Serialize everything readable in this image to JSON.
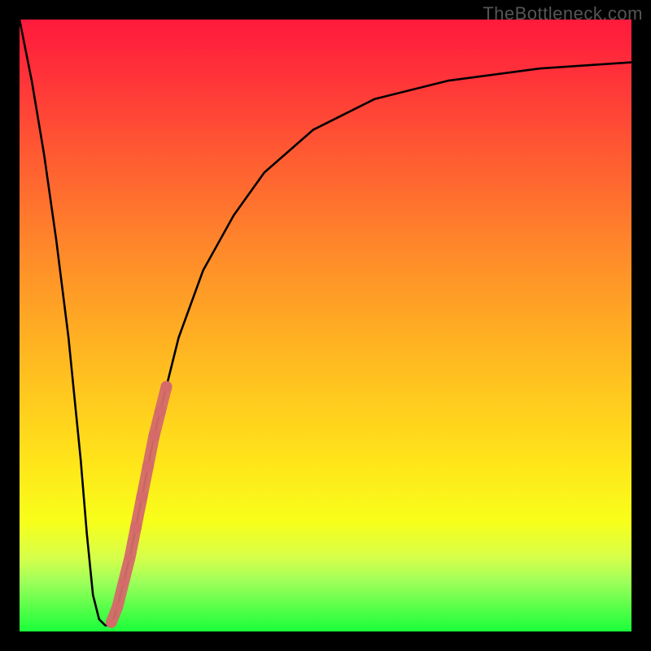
{
  "watermark": "TheBottleneck.com",
  "chart_data": {
    "type": "line",
    "title": "",
    "xlabel": "",
    "ylabel": "",
    "xlim": [
      0,
      100
    ],
    "ylim": [
      0,
      100
    ],
    "series": [
      {
        "name": "bottleneck-curve",
        "x": [
          0,
          2,
          4,
          6,
          8,
          10,
          11,
          12,
          13,
          14,
          15,
          16,
          18,
          20,
          22,
          24,
          26,
          30,
          35,
          40,
          48,
          58,
          70,
          85,
          100
        ],
        "y": [
          100,
          90,
          78,
          64,
          48,
          28,
          16,
          6,
          2,
          1,
          1,
          4,
          12,
          22,
          32,
          40,
          48,
          59,
          68,
          75,
          82,
          87,
          90,
          92,
          93
        ]
      }
    ],
    "scatter": {
      "name": "highlight-points",
      "color": "#d46a6a",
      "points": [
        {
          "x": 15.0,
          "y": 1.5,
          "r": 5
        },
        {
          "x": 16.0,
          "y": 4.0,
          "r": 5
        },
        {
          "x": 17.0,
          "y": 8.0,
          "r": 5
        },
        {
          "x": 18.0,
          "y": 12.0,
          "r": 5
        },
        {
          "x": 19.0,
          "y": 17.0,
          "r": 7
        },
        {
          "x": 20.0,
          "y": 22.0,
          "r": 7
        },
        {
          "x": 21.0,
          "y": 27.0,
          "r": 7
        },
        {
          "x": 22.0,
          "y": 32.0,
          "r": 7
        },
        {
          "x": 23.0,
          "y": 36.0,
          "r": 7
        },
        {
          "x": 24.0,
          "y": 40.0,
          "r": 7
        }
      ]
    },
    "gradient_background": {
      "top": "#ff1a3c",
      "mid": "#ffe41a",
      "bottom": "#1aff3a"
    }
  }
}
